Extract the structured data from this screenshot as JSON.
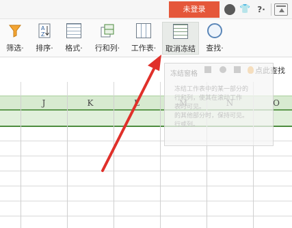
{
  "topbar": {
    "login_label": "未登录",
    "help_label": "?·"
  },
  "ribbon": {
    "items": [
      {
        "label": "筛选·"
      },
      {
        "label": "排序·"
      },
      {
        "label": "格式·"
      },
      {
        "label": "行和列·"
      },
      {
        "label": "工作表·"
      },
      {
        "label": "取消冻结"
      },
      {
        "label": "查找·"
      }
    ]
  },
  "popup": {
    "title": "冻结窗格",
    "lines": [
      "冻结工作表中的某一部分的",
      "行和列，使其在滚动工作",
      "表时可见。",
      "",
      "的其他部分时，保持可见。",
      "行或列。"
    ]
  },
  "search_tip": "点此查找",
  "columns": [
    "J",
    "K",
    "L",
    "M",
    "N",
    "O"
  ],
  "colors": {
    "login_bg": "#e5573a",
    "frozen_highlight": "#d7ead0",
    "freeze_line": "#4c8c3e",
    "arrow": "#e0302a"
  }
}
